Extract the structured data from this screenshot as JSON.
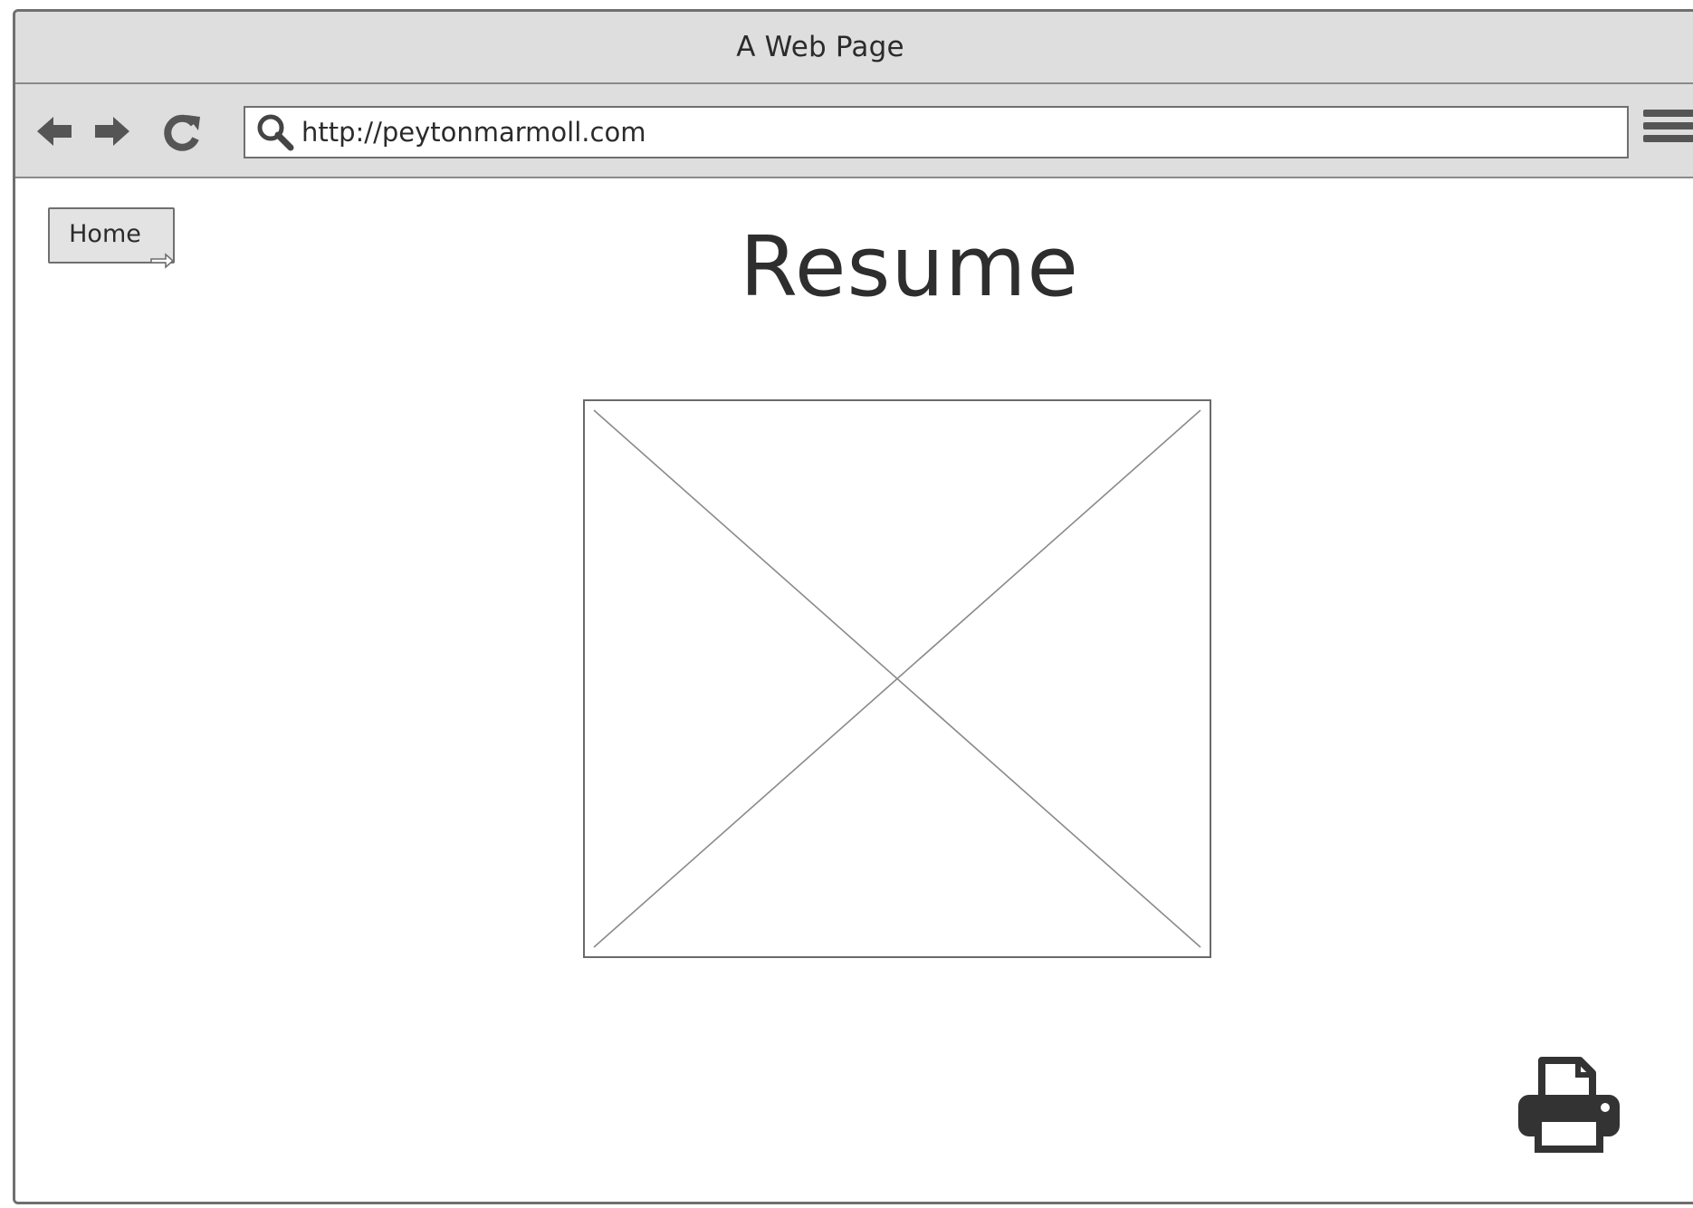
{
  "window": {
    "title": "A Web Page"
  },
  "toolbar": {
    "back_icon": "arrow-left-icon",
    "forward_icon": "arrow-right-icon",
    "reload_icon": "reload-icon",
    "url": "http://peytonmarmoll.com",
    "search_icon": "search-icon",
    "menu_icon": "hamburger-menu-icon"
  },
  "page": {
    "home_label": "Home",
    "heading": "Resume",
    "image_placeholder_icon": "image-placeholder",
    "print_icon": "printer-icon"
  },
  "colors": {
    "chrome_bg": "#dedede",
    "border": "#6f6f6f",
    "icon": "#555555",
    "text": "#2b2b2b"
  }
}
